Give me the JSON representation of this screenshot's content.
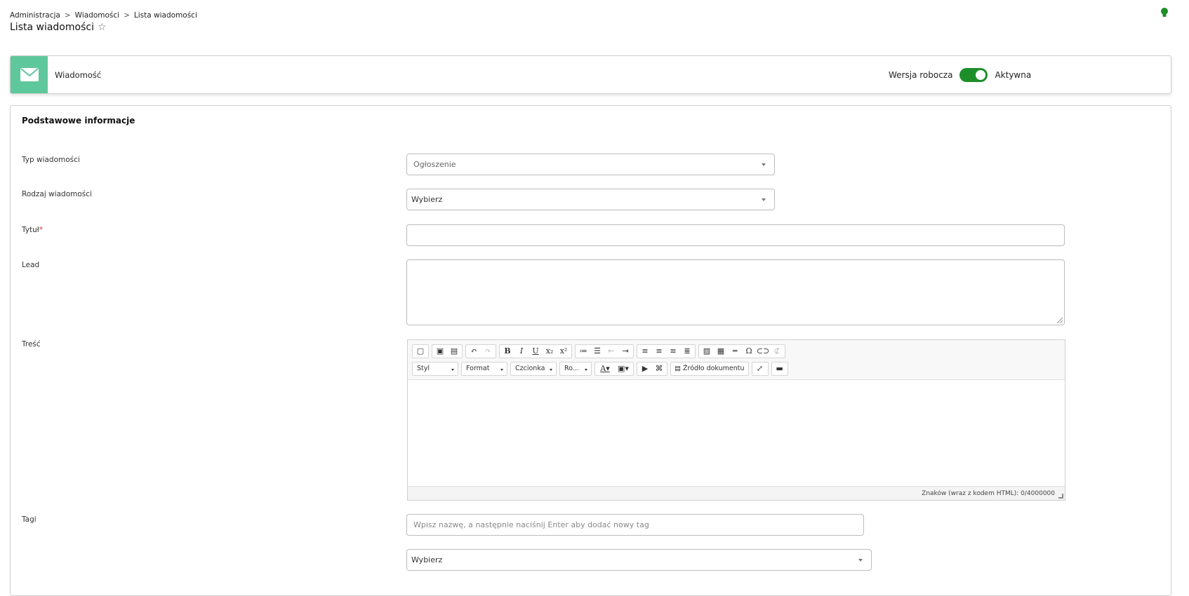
{
  "breadcrumb": {
    "items": [
      "Administracja",
      "Wiadomości",
      "Lista wiadomości"
    ],
    "separator": ">"
  },
  "page": {
    "title": "Lista wiadomości"
  },
  "header": {
    "title": "Wiadomość",
    "status_left": "Wersja robocza",
    "status_right": "Aktywna",
    "toggle_on": true
  },
  "form": {
    "section_title": "Podstawowe informacje",
    "type_label": "Typ wiadomości",
    "type_value": "Ogłoszenie",
    "kind_label": "Rodzaj wiadomości",
    "kind_value": "Wybierz",
    "title_label": "Tytuł",
    "title_required": "*",
    "title_value": "",
    "lead_label": "Lead",
    "lead_value": "",
    "content_label": "Treść",
    "tags_label": "Tagi",
    "tags_placeholder": "Wpisz nazwę, a następnie naciśnij Enter aby dodać nowy tag",
    "tags_select_value": "Wybierz"
  },
  "editor": {
    "combos": [
      "Styl",
      "Format",
      "Czcionka",
      "Ro..."
    ],
    "source_label": "Źródło dokumentu",
    "counter_text": "Znaków (wraz z kodem HTML): 0/4000000"
  },
  "colors": {
    "accent": "#1e8e2a",
    "mail_tile": "#5fc79c",
    "bulb": "#1e8e2a"
  }
}
